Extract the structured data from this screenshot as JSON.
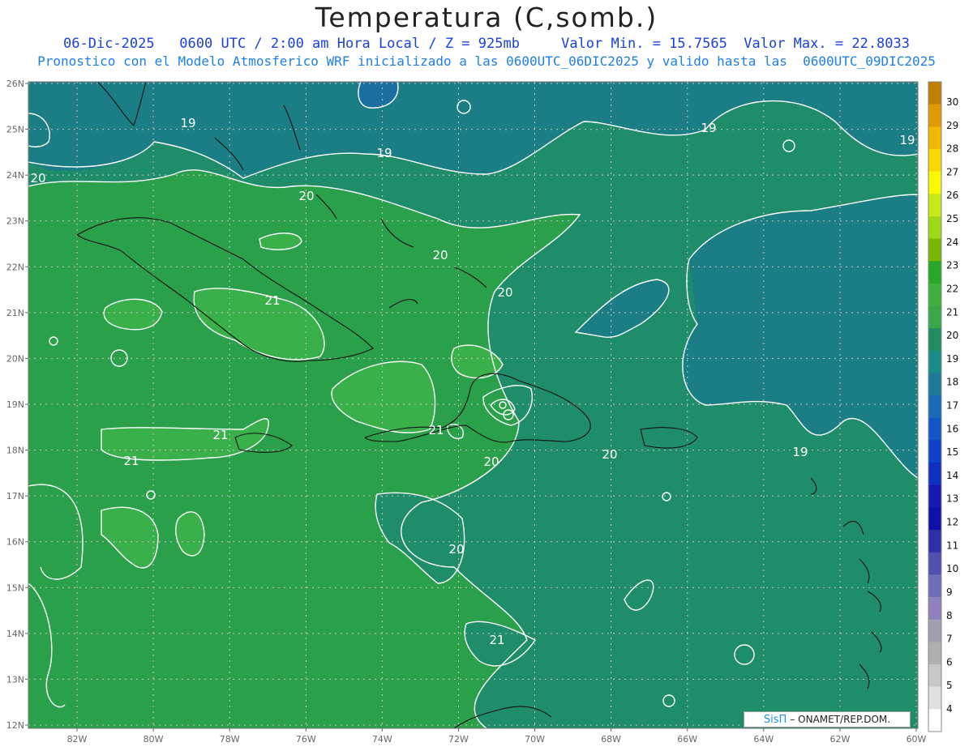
{
  "title": "Temperatura (C,somb.)",
  "subtitle_line1": "06-Dic-2025   0600 UTC / 2:00 am Hora Local / Z = 925mb     Valor Min. = 15.7565  Valor Max. = 22.8033",
  "subtitle_line2": "Pronostico con el Modelo Atmosferico WRF inicializado a las 0600UTC_06DIC2025 y valido hasta las  0600UTC_09DIC2025",
  "latitude_labels": [
    "26N",
    "25N",
    "24N",
    "23N",
    "22N",
    "21N",
    "20N",
    "19N",
    "18N",
    "17N",
    "16N",
    "15N",
    "14N",
    "13N",
    "12N"
  ],
  "longitude_labels": [
    "82W",
    "80W",
    "78W",
    "76W",
    "74W",
    "72W",
    "70W",
    "68W",
    "66W",
    "64W",
    "62W",
    "60W"
  ],
  "colorbar": {
    "labels": [
      "30",
      "29",
      "28",
      "27",
      "26",
      "25",
      "24",
      "23",
      "22",
      "21",
      "20",
      "19",
      "18",
      "17",
      "16",
      "15",
      "14",
      "13",
      "12",
      "11",
      "10",
      "9",
      "8",
      "7",
      "6",
      "5",
      "4"
    ],
    "colors": [
      "#c08000",
      "#e09a00",
      "#f0b800",
      "#f8d800",
      "#f8f800",
      "#c8e818",
      "#a0d818",
      "#78b800",
      "#28a828",
      "#40b040",
      "#3aa848",
      "#208c62",
      "#1a8c88",
      "#1e7a9a",
      "#1a6ab8",
      "#1456c8",
      "#1040c8",
      "#1030c0",
      "#1818b0",
      "#1010a8",
      "#3030a8",
      "#5050b0",
      "#7070b8",
      "#9080c0",
      "#a0a0b0",
      "#b0b0b0",
      "#c8c8c8",
      "#e0e0e0",
      "#ffffff"
    ]
  },
  "contour_labels": [
    {
      "text": "19"
    },
    {
      "text": "19"
    },
    {
      "text": "19"
    },
    {
      "text": "19"
    },
    {
      "text": "19"
    },
    {
      "text": "20"
    },
    {
      "text": "20"
    },
    {
      "text": "20"
    },
    {
      "text": "20"
    },
    {
      "text": "20"
    },
    {
      "text": "20"
    },
    {
      "text": "20"
    },
    {
      "text": "21"
    },
    {
      "text": "21"
    },
    {
      "text": "21"
    },
    {
      "text": "21"
    }
  ],
  "credit": {
    "logo": "SisΠ",
    "text": "– ONAMET/REP.DOM."
  }
}
